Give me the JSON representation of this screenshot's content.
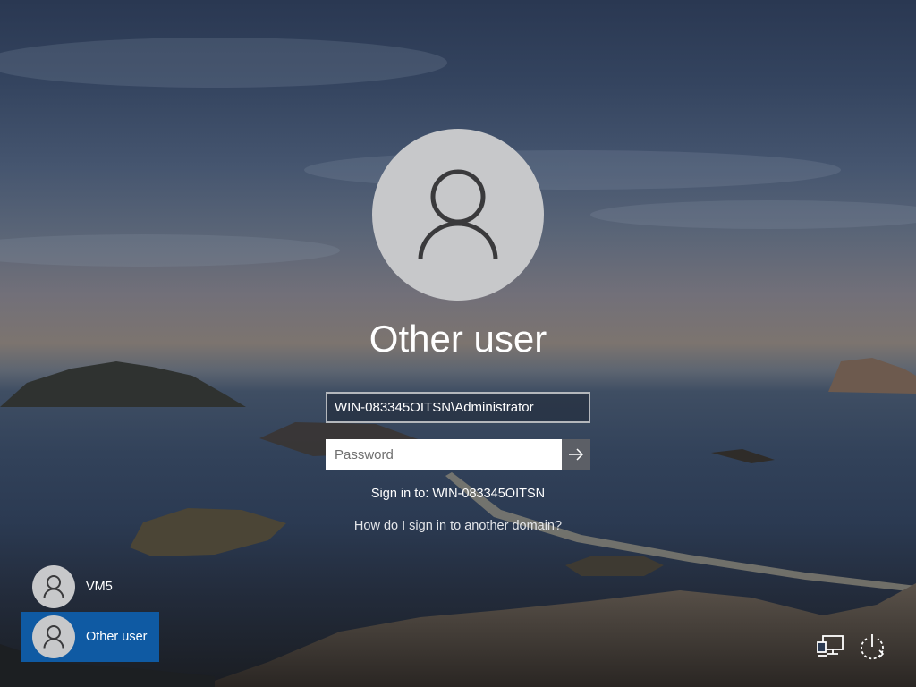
{
  "user": {
    "display_name": "Other user",
    "account": "WIN-083345OITSN\\Administrator"
  },
  "password": {
    "placeholder": "Password",
    "submit_icon": "arrow-right-icon"
  },
  "sign_in_to": "Sign in to: WIN-083345OITSN",
  "help_link": "How do I sign in to another domain?",
  "users": [
    {
      "label": "VM5",
      "selected": false
    },
    {
      "label": "Other user",
      "selected": true
    }
  ],
  "corner_icons": [
    "network-icon",
    "power-icon"
  ],
  "colors": {
    "selected_tile": "#0f5aa3",
    "avatar_bg": "#c7c8ca",
    "avatar_glyph": "#3a3a3c",
    "submit_button": "#5c5f66"
  }
}
